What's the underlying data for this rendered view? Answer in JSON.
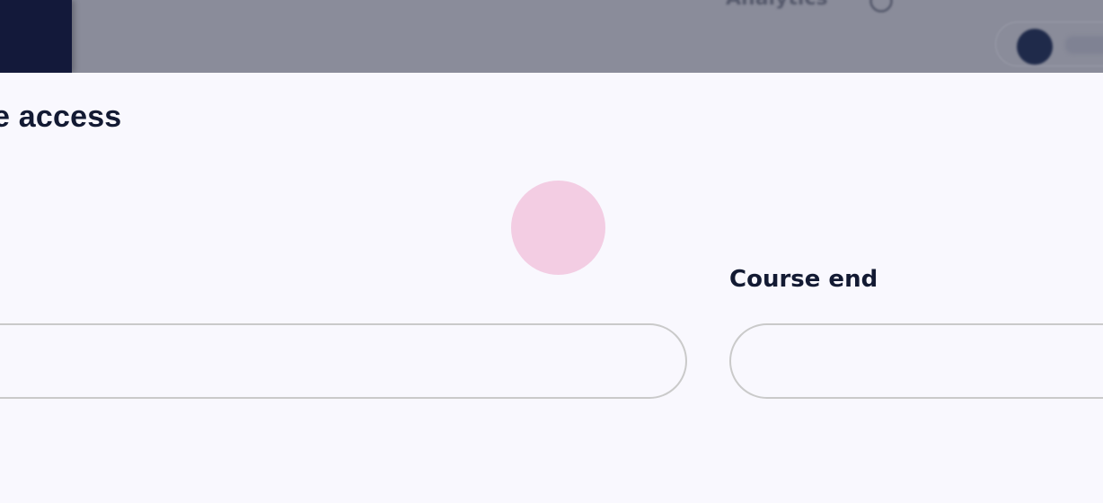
{
  "backdrop": {
    "header_label": "Analytics",
    "header_icon": "help-circle-icon",
    "avatar_icon": "avatar"
  },
  "modal": {
    "title": "e access",
    "fields": {
      "start": {
        "label": "",
        "value": ""
      },
      "end": {
        "label": "Course end",
        "value": ""
      }
    }
  },
  "colors": {
    "text": "#131a33",
    "background": "#f9f8fe",
    "input_border": "#cacaca",
    "nav": "#13193a",
    "overlay": "#8a8c9a",
    "click_indicator": "#f3cde3"
  }
}
